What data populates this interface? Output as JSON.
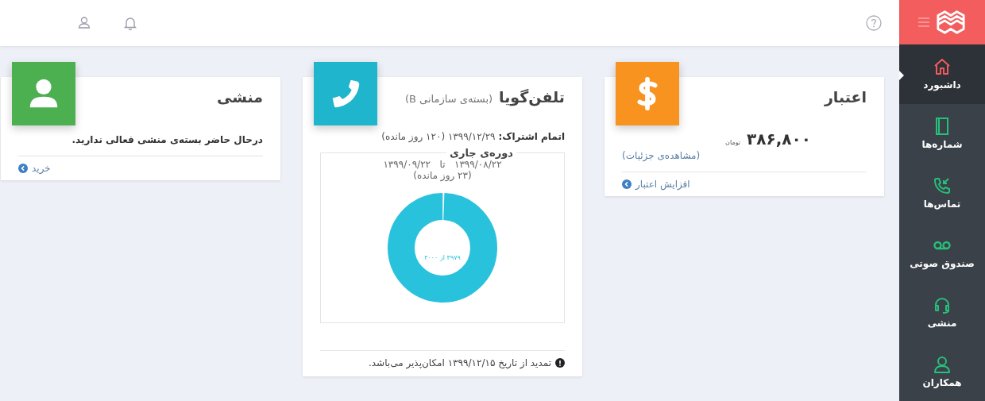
{
  "sidebar": {
    "items": [
      {
        "label": "داشبورد",
        "kind": "home",
        "selected": true
      },
      {
        "label": "شماره‌ها",
        "kind": "book",
        "selected": false
      },
      {
        "label": "تماس‌ها",
        "kind": "call",
        "selected": false
      },
      {
        "label": "صندوق صوتی",
        "kind": "voicemail",
        "selected": false
      },
      {
        "label": "منشی",
        "kind": "headset",
        "selected": false
      },
      {
        "label": "همکاران",
        "kind": "people",
        "selected": false
      }
    ]
  },
  "credit": {
    "title": "اعتبار",
    "amount": "۳۸۶,۸۰۰",
    "unit": "تومان",
    "details_link": "(مشاهده‌ی جزئیات)",
    "action": "افزایش اعتبار"
  },
  "phone": {
    "title": "تلفن‌گویا",
    "subtitle": "(بسته‌ی سازمانی B)",
    "expiry": "**اتمام اشتراک:** ۱۳۹۹/۱۲/۲۹ (۱۲۰ روز مانده)",
    "period": {
      "legend": "دوره‌ی جاری",
      "range": "۱۳۹۹/۰۸/۲۲   تا   ۱۳۹۹/۰۹/۲۲",
      "remaining": "(۲۳ روز مانده)",
      "usage": {
        "reading": "۳۹۷۹ از ۴۰۰۰",
        "level": 0.995
      }
    },
    "note": "تمدید از تاریخ ۱۳۹۹/۱۲/۱۵ امکان‌پذیر می‌باشد."
  },
  "secretary": {
    "title": "منشی",
    "message": "درحال حاضر بسته‌ی منشی فعالی ندارید.",
    "action": "خرید"
  }
}
